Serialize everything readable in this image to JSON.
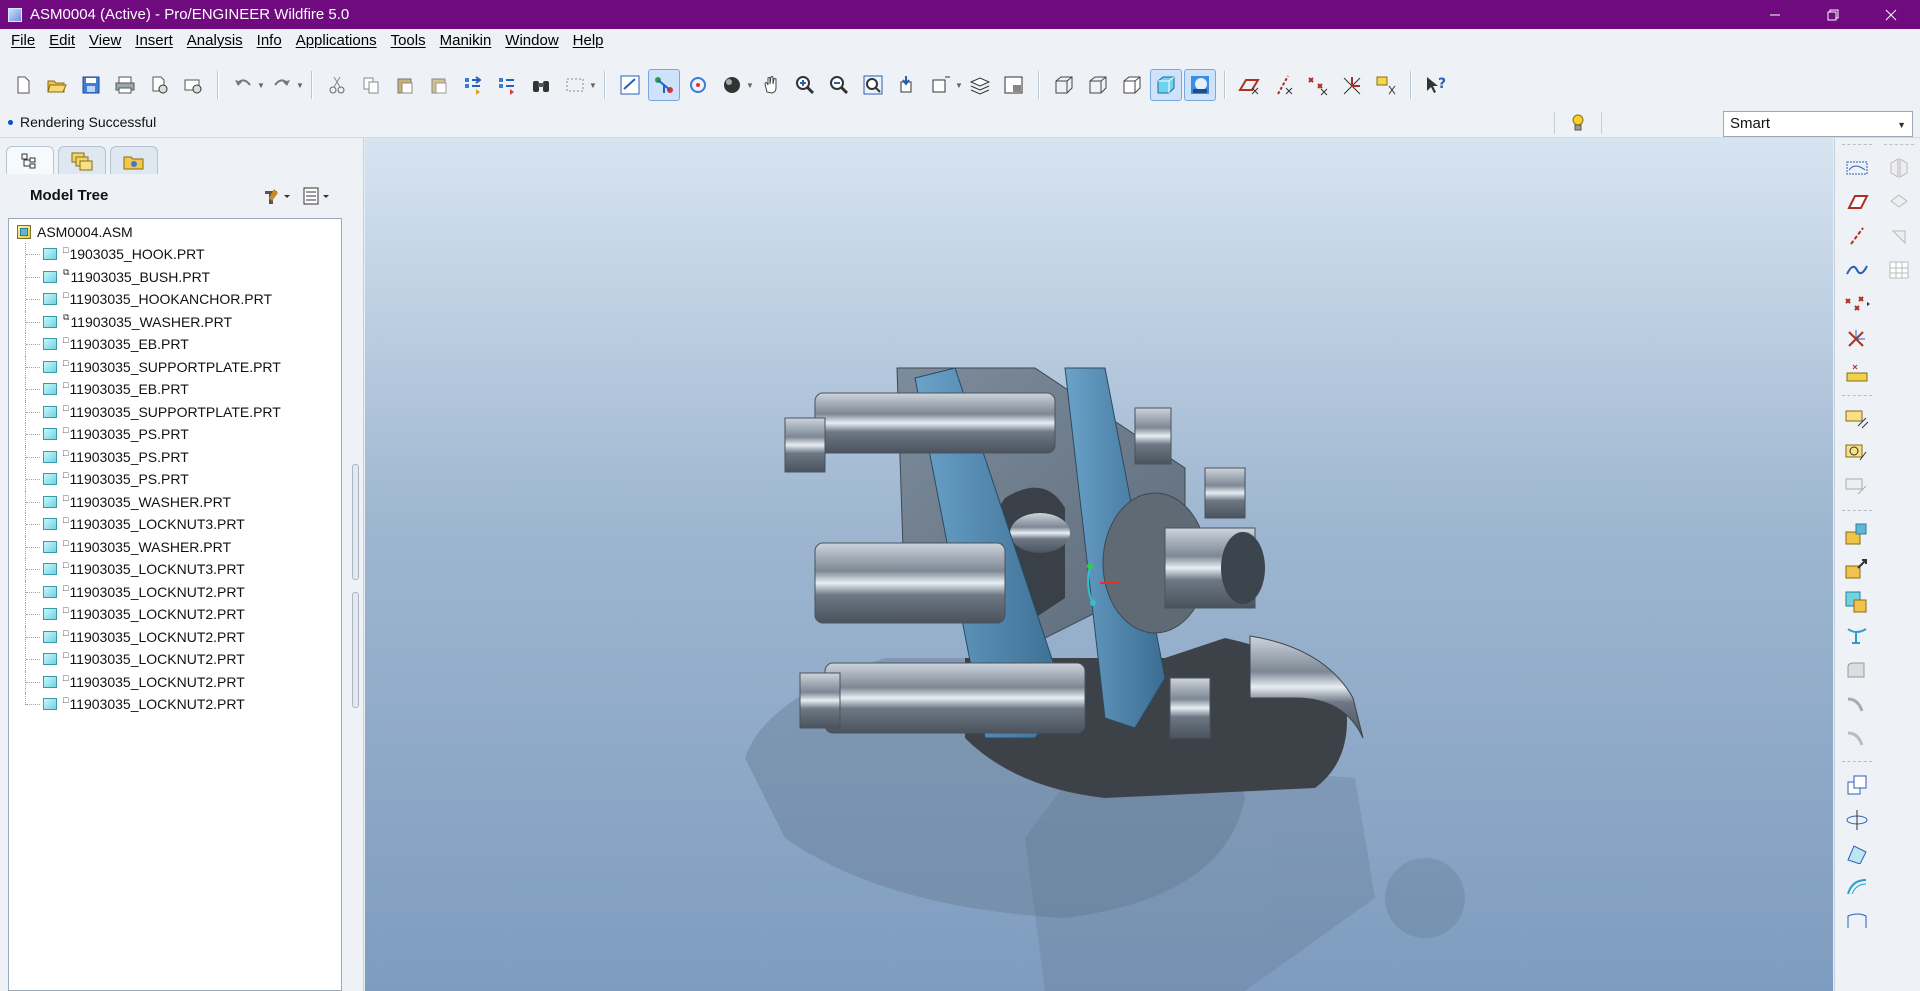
{
  "window": {
    "title": "ASM0004 (Active) - Pro/ENGINEER Wildfire 5.0",
    "controls": [
      "minimize",
      "restore",
      "close"
    ]
  },
  "menu": [
    "File",
    "Edit",
    "View",
    "Insert",
    "Analysis",
    "Info",
    "Applications",
    "Tools",
    "Manikin",
    "Window",
    "Help"
  ],
  "status": {
    "message": "Rendering Successful",
    "filter": "Smart"
  },
  "navigator": {
    "tabs": [
      "model-tree-tab",
      "layers-tab",
      "folder-browser-tab"
    ],
    "tree_title": "Model Tree",
    "root": "ASM0004.ASM",
    "items": [
      "1903035_HOOK.PRT",
      "11903035_BUSH.PRT",
      "11903035_HOOKANCHOR.PRT",
      "11903035_WASHER.PRT",
      "11903035_EB.PRT",
      "11903035_SUPPORTPLATE.PRT",
      "11903035_EB.PRT",
      "11903035_SUPPORTPLATE.PRT",
      "11903035_PS.PRT",
      "11903035_PS.PRT",
      "11903035_PS.PRT",
      "11903035_WASHER.PRT",
      "11903035_LOCKNUT3.PRT",
      "11903035_WASHER.PRT",
      "11903035_LOCKNUT3.PRT",
      "11903035_LOCKNUT2.PRT",
      "11903035_LOCKNUT2.PRT",
      "11903035_LOCKNUT2.PRT",
      "11903035_LOCKNUT2.PRT",
      "11903035_LOCKNUT2.PRT",
      "11903035_LOCKNUT2.PRT"
    ]
  },
  "toolbar_icons": [
    "new-icon",
    "open-icon",
    "save-icon",
    "print-icon",
    "send-mail-icon",
    "mail-attach-icon",
    "undo-icon",
    "redo-icon",
    "cut-icon",
    "copy-icon",
    "paste-icon",
    "paste-special-icon",
    "regenerate-icon",
    "regen-manager-icon",
    "find-icon",
    "select-box-icon",
    "repaint-icon",
    "orient-mode-icon",
    "spin-center-icon",
    "display-style-icon",
    "pan-icon",
    "zoom-in-icon",
    "zoom-out-icon",
    "refit-icon",
    "reorient-icon",
    "saved-views-icon",
    "layers-icon",
    "view-manager-icon",
    "wireframe-icon",
    "hidden-line-icon",
    "no-hidden-icon",
    "shading-icon",
    "enhanced-realism-icon",
    "datum-planes-display-icon",
    "datum-axes-display-icon",
    "point-display-icon",
    "csys-display-icon",
    "annotation-display-icon",
    "context-help-icon"
  ],
  "right_toolbar_icons": {
    "datums": [
      "datum-plane-icon",
      "datum-axis-icon",
      "datum-curve-icon",
      "datum-point-icon",
      "datum-csys-icon",
      "analysis-feature-icon",
      "sketch-icon"
    ],
    "annotations": [
      "annotation-feature-icon",
      "surface-finish-icon",
      "note-icon"
    ],
    "components": [
      "assemble-icon",
      "create-component-icon",
      "package-icon",
      "cut-out-icon",
      "round-icon",
      "chamfer-icon",
      "draft-icon"
    ],
    "editing": [
      "mirror-icon",
      "pattern-icon",
      "extend-icon",
      "offset-icon",
      "boundary-icon"
    ],
    "column2": [
      "mirror-tool-icon",
      "merge-icon",
      "trim-icon",
      "pattern-table-icon"
    ]
  }
}
